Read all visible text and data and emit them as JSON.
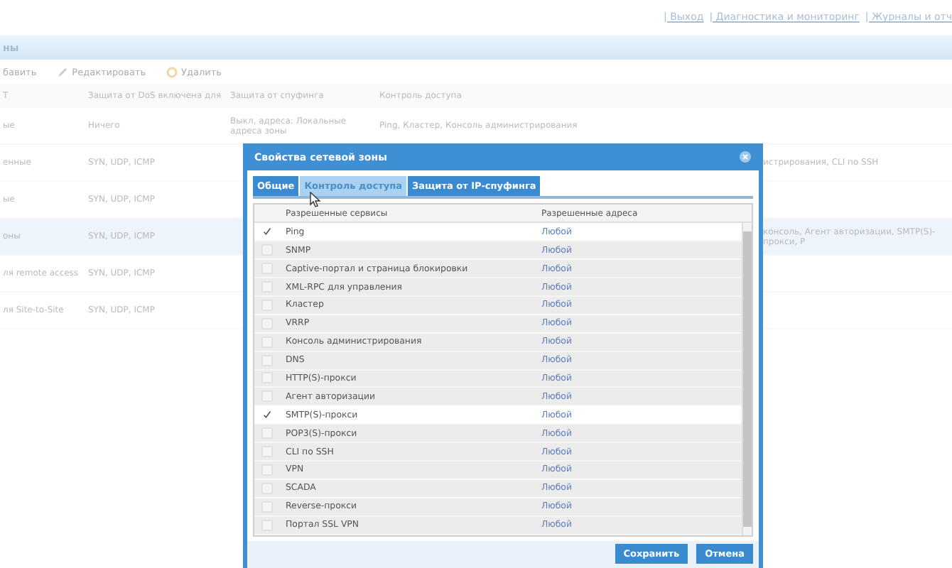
{
  "top_links": [
    "| Выход",
    "| Диагностика и мониторинг",
    "| Журналы и отч"
  ],
  "panel": {
    "title": "ны"
  },
  "toolbar": [
    {
      "kind": "add",
      "label": "бавить"
    },
    {
      "kind": "edit",
      "label": "Редактировать"
    },
    {
      "kind": "delete",
      "label": "Удалить"
    }
  ],
  "table": {
    "columns": [
      "Т",
      "Защита от DoS включена для",
      "Защита от спуфинга",
      "Контроль доступа"
    ],
    "rows": [
      {
        "selected": false,
        "cells": [
          "ые",
          "Ничего",
          "Выкл, адреса: Локальные адреса зоны",
          "Ping, Кластер, Консоль администрирования"
        ]
      },
      {
        "selected": false,
        "cells": [
          "енные",
          "SYN, UDP, ICMP",
          "",
          "истрирования, CLI по SSH"
        ]
      },
      {
        "selected": false,
        "cells": [
          "ые",
          "SYN, UDP, ICMP",
          "",
          ""
        ]
      },
      {
        "selected": true,
        "cells": [
          "оны",
          "SYN, UDP, ICMP",
          "",
          "консоль, Агент авторизации, SMTP(S)-прокси, P"
        ]
      },
      {
        "selected": false,
        "cells": [
          "ля remote access",
          "SYN, UDP, ICMP",
          "",
          ""
        ]
      },
      {
        "selected": false,
        "cells": [
          "ля Site-to-Site",
          "SYN, UDP, ICMP",
          "",
          ""
        ]
      }
    ]
  },
  "dialog": {
    "title": "Свойства сетевой зоны",
    "tabs": [
      {
        "label": "Общие",
        "selected": false
      },
      {
        "label": "Контроль доступа",
        "selected": true
      },
      {
        "label": "Защита от IP-спуфинга",
        "selected": false
      }
    ],
    "columns": [
      "Разрешенные сервисы",
      "Разрешенные адреса"
    ],
    "services": [
      {
        "name": "Ping",
        "address": "Любой",
        "checked": true
      },
      {
        "name": "SNMP",
        "address": "Любой",
        "checked": false
      },
      {
        "name": "Captive-портал и страница блокировки",
        "address": "Любой",
        "checked": false
      },
      {
        "name": "XML-RPC для управления",
        "address": "Любой",
        "checked": false
      },
      {
        "name": "Кластер",
        "address": "Любой",
        "checked": false
      },
      {
        "name": "VRRP",
        "address": "Любой",
        "checked": false
      },
      {
        "name": "Консоль администрирования",
        "address": "Любой",
        "checked": false
      },
      {
        "name": "DNS",
        "address": "Любой",
        "checked": false
      },
      {
        "name": "HTTP(S)-прокси",
        "address": "Любой",
        "checked": false
      },
      {
        "name": "Агент авторизации",
        "address": "Любой",
        "checked": false
      },
      {
        "name": "SMTP(S)-прокси",
        "address": "Любой",
        "checked": true
      },
      {
        "name": "POP3(S)-прокси",
        "address": "Любой",
        "checked": false
      },
      {
        "name": "CLI по SSH",
        "address": "Любой",
        "checked": false
      },
      {
        "name": "VPN",
        "address": "Любой",
        "checked": false
      },
      {
        "name": "SCADA",
        "address": "Любой",
        "checked": false
      },
      {
        "name": "Reverse-прокси",
        "address": "Любой",
        "checked": false
      },
      {
        "name": "Портал SSL VPN",
        "address": "Любой",
        "checked": false
      }
    ],
    "buttons": [
      "Сохранить",
      "Отмена"
    ]
  }
}
